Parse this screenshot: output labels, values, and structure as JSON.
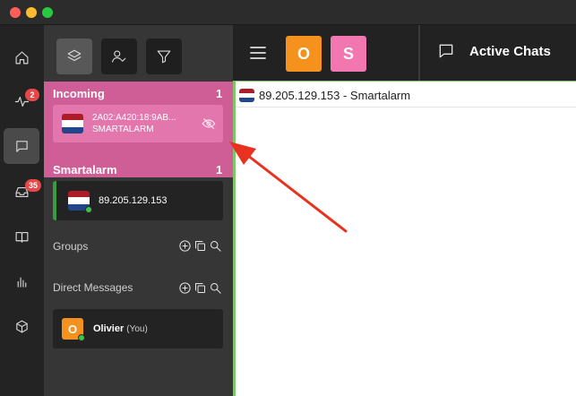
{
  "window": {
    "controls": [
      {
        "name": "close",
        "color": "#ff5f57"
      },
      {
        "name": "minimize",
        "color": "#febc2e"
      },
      {
        "name": "zoom",
        "color": "#28c840"
      }
    ]
  },
  "rail": {
    "items": [
      {
        "icon": "home-icon",
        "badge": null,
        "active": false
      },
      {
        "icon": "activity-icon",
        "badge": "2",
        "active": false
      },
      {
        "icon": "chat-icon",
        "badge": null,
        "active": true
      },
      {
        "icon": "inbox-icon",
        "badge": "35",
        "active": false
      },
      {
        "icon": "book-icon",
        "badge": null,
        "active": false
      },
      {
        "icon": "bar-chart-icon",
        "badge": null,
        "active": false
      },
      {
        "icon": "cube-icon",
        "badge": null,
        "active": false
      }
    ]
  },
  "toolbar": {
    "buttons": [
      {
        "icon": "layers-icon",
        "active": true
      },
      {
        "icon": "user-check-icon",
        "active": false
      },
      {
        "icon": "filter-icon",
        "active": false
      }
    ]
  },
  "incoming": {
    "title": "Incoming",
    "count": "1",
    "item": {
      "line1": "2A02:A420:18:9AB...",
      "line2": "SMARTALARM",
      "icon": "eye-off-icon"
    }
  },
  "smartalarm": {
    "title": "Smartalarm",
    "count": "1",
    "item": {
      "label": "89.205.129.153"
    }
  },
  "groups": {
    "label": "Groups"
  },
  "direct_messages": {
    "label": "Direct Messages",
    "item": {
      "initial": "O",
      "name": "Olivier",
      "suffix": "(You)"
    }
  },
  "topbar": {
    "avatars": [
      {
        "letter": "O",
        "color": "#f5921e"
      },
      {
        "letter": "S",
        "color": "#f277b0"
      }
    ],
    "active_chats_label": "Active Chats"
  },
  "chat": {
    "tab_title": "89.205.129.153 - Smartalarm"
  },
  "colors": {
    "incoming_bg": "#cf5e96",
    "incoming_card": "#e276ad",
    "accent_green": "#3a9a3f",
    "badge_red": "#e54848",
    "arrow_red": "#e8321f"
  }
}
